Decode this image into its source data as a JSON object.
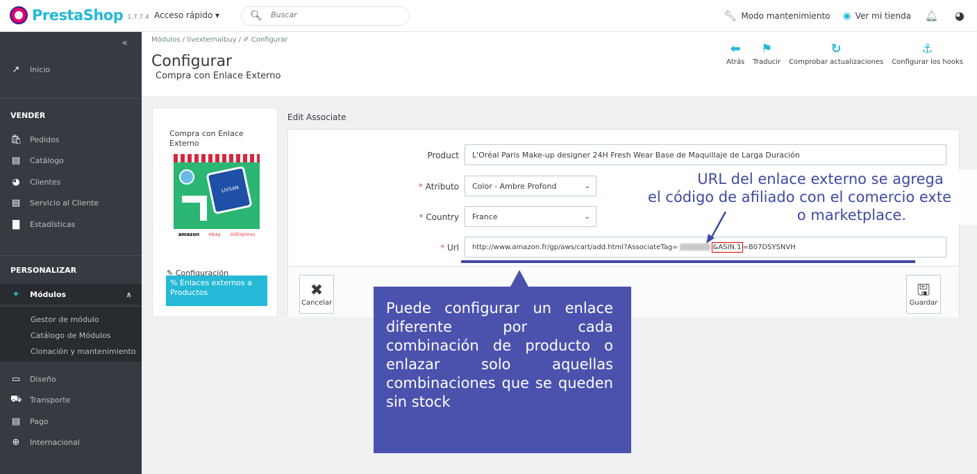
{
  "app": {
    "brand": "PrestaShop",
    "version": "1.7.7.4",
    "quick_access": "Acceso rápido ▾",
    "search_placeholder": "Buscar",
    "maintenance": "Modo mantenimiento",
    "view_store": "Ver mi tienda",
    "colors": {
      "accent": "#25b9d7",
      "sidebar": "#363a41",
      "callout": "#4b52ae",
      "note_text": "#3f49a5"
    }
  },
  "sidebar": {
    "collapse_icon": "«",
    "home": "Inicio",
    "section_sell": "VENDER",
    "sell_items": [
      "Pedidos",
      "Catálogo",
      "Clientes",
      "Servicio al Cliente",
      "Estadísticas"
    ],
    "section_customize": "PERSONALIZAR",
    "modules": "Módulos",
    "modules_sub": [
      "Gestor de módulo",
      "Catálogo de Módulos",
      "Clonación y mantenimiento"
    ],
    "customize_items": [
      "Diseño",
      "Transporte",
      "Pago",
      "Internacional"
    ]
  },
  "header": {
    "breadcrumb": "Módulos  /  livexternalbuy  /  ✐ Configurar",
    "title": "Configurar",
    "subtitle": "Compra con Enlace Externo",
    "toolbar": [
      "Atrás",
      "Traducir",
      "Comprobar actualizaciones",
      "Configurar los hooks"
    ]
  },
  "module_card": {
    "name": "Compra con Enlace Externo",
    "image_label": "LIVSAN",
    "brands": [
      "amazon",
      "ebay",
      "AliExpress"
    ],
    "config_link": "Configuración",
    "tab": "% Enlaces externos a Productos"
  },
  "form": {
    "title": "Edit Associate",
    "product_label": "Product",
    "product_value": "L'Oréal Paris Make-up designer 24H Fresh Wear Base de Maquillaje de Larga Duración",
    "attribute_label": "Atributo",
    "attribute_value": "Color - Ambre Profond",
    "country_label": "Country",
    "country_value": "France",
    "url_label": "Url",
    "url_prefix": "http://www.amazon.fr/gp/aws/cart/add.html?AssociateTag=",
    "url_highlight": "&ASIN.1",
    "url_suffix": "=B07DSYSNVH",
    "cancel": "Cancelar",
    "save": "Guardar"
  },
  "annotations": {
    "url_note_line1": "URL del enlace externo se agrega",
    "url_note_line2": "el código de afiliado con el comercio exte",
    "url_note_line3": "o marketplace.",
    "callout": "Puede configurar un enlace diferente por cada combinación de producto o enlazar solo aquellas combinaciones que se queden sin stock"
  }
}
